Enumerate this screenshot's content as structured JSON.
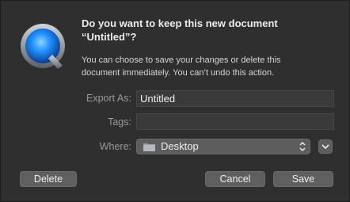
{
  "dialog": {
    "title_line1": "Do you want to keep this new document",
    "title_line2": "“Untitled”?",
    "message_line1": "You can choose to save your changes or delete this",
    "message_line2": "document immediately. You can’t undo this action.",
    "app_icon": "quicktime-icon"
  },
  "form": {
    "export_as_label": "Export As:",
    "export_as_value": "Untitled",
    "tags_label": "Tags:",
    "tags_value": "",
    "where_label": "Where:",
    "where_value": "Desktop",
    "where_icon": "folder-icon",
    "where_control_icon": "updown-chevron-icon",
    "expand_icon": "chevron-down-icon"
  },
  "buttons": {
    "delete": "Delete",
    "cancel": "Cancel",
    "save": "Save"
  },
  "colors": {
    "background": "#2f2f2f",
    "button": "#5f5f5f",
    "field": "#3a3a3a",
    "qt_blue": "#1e90ff"
  }
}
